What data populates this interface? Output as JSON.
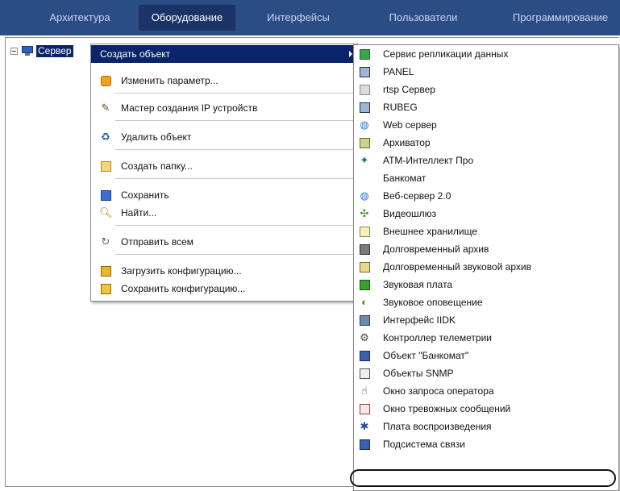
{
  "tabs": [
    {
      "label": "Архитектура",
      "active": false
    },
    {
      "label": "Оборудование",
      "active": true
    },
    {
      "label": "Интерфейсы",
      "active": false
    },
    {
      "label": "Пользователи",
      "active": false
    },
    {
      "label": "Программирование",
      "active": false
    }
  ],
  "tree": {
    "root_label": "Сервер",
    "root_icon": "monitor-icon"
  },
  "context_menu": {
    "items": [
      {
        "label": "Создать объект",
        "icon": "",
        "highlighted": true,
        "has_submenu": true
      },
      {
        "label": "Изменить параметр...",
        "icon": "edit-icon"
      },
      {
        "label": "Мастер создания IP устройств",
        "icon": "wand-icon"
      },
      {
        "label": "Удалить объект",
        "icon": "delete-icon"
      },
      {
        "label": "Создать папку...",
        "icon": "new-folder-icon"
      },
      {
        "label": "Сохранить",
        "icon": "save-icon"
      },
      {
        "label": "Найти...",
        "icon": "search-icon"
      },
      {
        "label": "Отправить всем",
        "icon": "send-icon"
      },
      {
        "label": "Загрузить конфигурацию...",
        "icon": "load-config-icon"
      },
      {
        "label": "Сохранить конфигурацию...",
        "icon": "save-config-icon"
      }
    ]
  },
  "submenu": {
    "items": [
      {
        "label": "Сервис репликации данных",
        "icon": "replication-icon"
      },
      {
        "label": "PANEL",
        "icon": "panel-icon"
      },
      {
        "label": "rtsp Сервер",
        "icon": "rtsp-server-icon"
      },
      {
        "label": "RUBEG",
        "icon": "rubeg-icon"
      },
      {
        "label": "Web сервер",
        "icon": "globe-icon"
      },
      {
        "label": "Архиватор",
        "icon": "archiver-icon"
      },
      {
        "label": "АТМ-Интеллект Про",
        "icon": "atm-intellect-icon"
      },
      {
        "label": "Банкомат",
        "icon": ""
      },
      {
        "label": "Веб-сервер 2.0",
        "icon": "globe-icon"
      },
      {
        "label": "Видеошлюз",
        "icon": "video-gateway-icon"
      },
      {
        "label": "Внешнее хранилище",
        "icon": "external-storage-icon"
      },
      {
        "label": "Долговременный архив",
        "icon": "long-term-archive-icon"
      },
      {
        "label": "Долговременный звуковой архив",
        "icon": "audio-archive-icon"
      },
      {
        "label": "Звуковая плата",
        "icon": "sound-card-icon"
      },
      {
        "label": "Звуковое оповещение",
        "icon": "sound-alert-icon"
      },
      {
        "label": "Интерфейс IIDK",
        "icon": "iidk-icon"
      },
      {
        "label": "Контроллер телеметрии",
        "icon": "telemetry-icon"
      },
      {
        "label": "Объект \"Банкомат\"",
        "icon": "atm-object-icon"
      },
      {
        "label": "Объекты SNMP",
        "icon": "snmp-icon"
      },
      {
        "label": "Окно запроса оператора",
        "icon": "operator-request-icon"
      },
      {
        "label": "Окно тревожных сообщений",
        "icon": "alarm-window-icon"
      },
      {
        "label": "Плата воспроизведения",
        "icon": "playback-board-icon"
      },
      {
        "label": "Подсистема связи",
        "icon": "comm-subsystem-icon"
      }
    ]
  },
  "colors": {
    "tabbar": "#2a4d86",
    "tab_active": "#1b3467",
    "highlight": "#0a246a"
  }
}
